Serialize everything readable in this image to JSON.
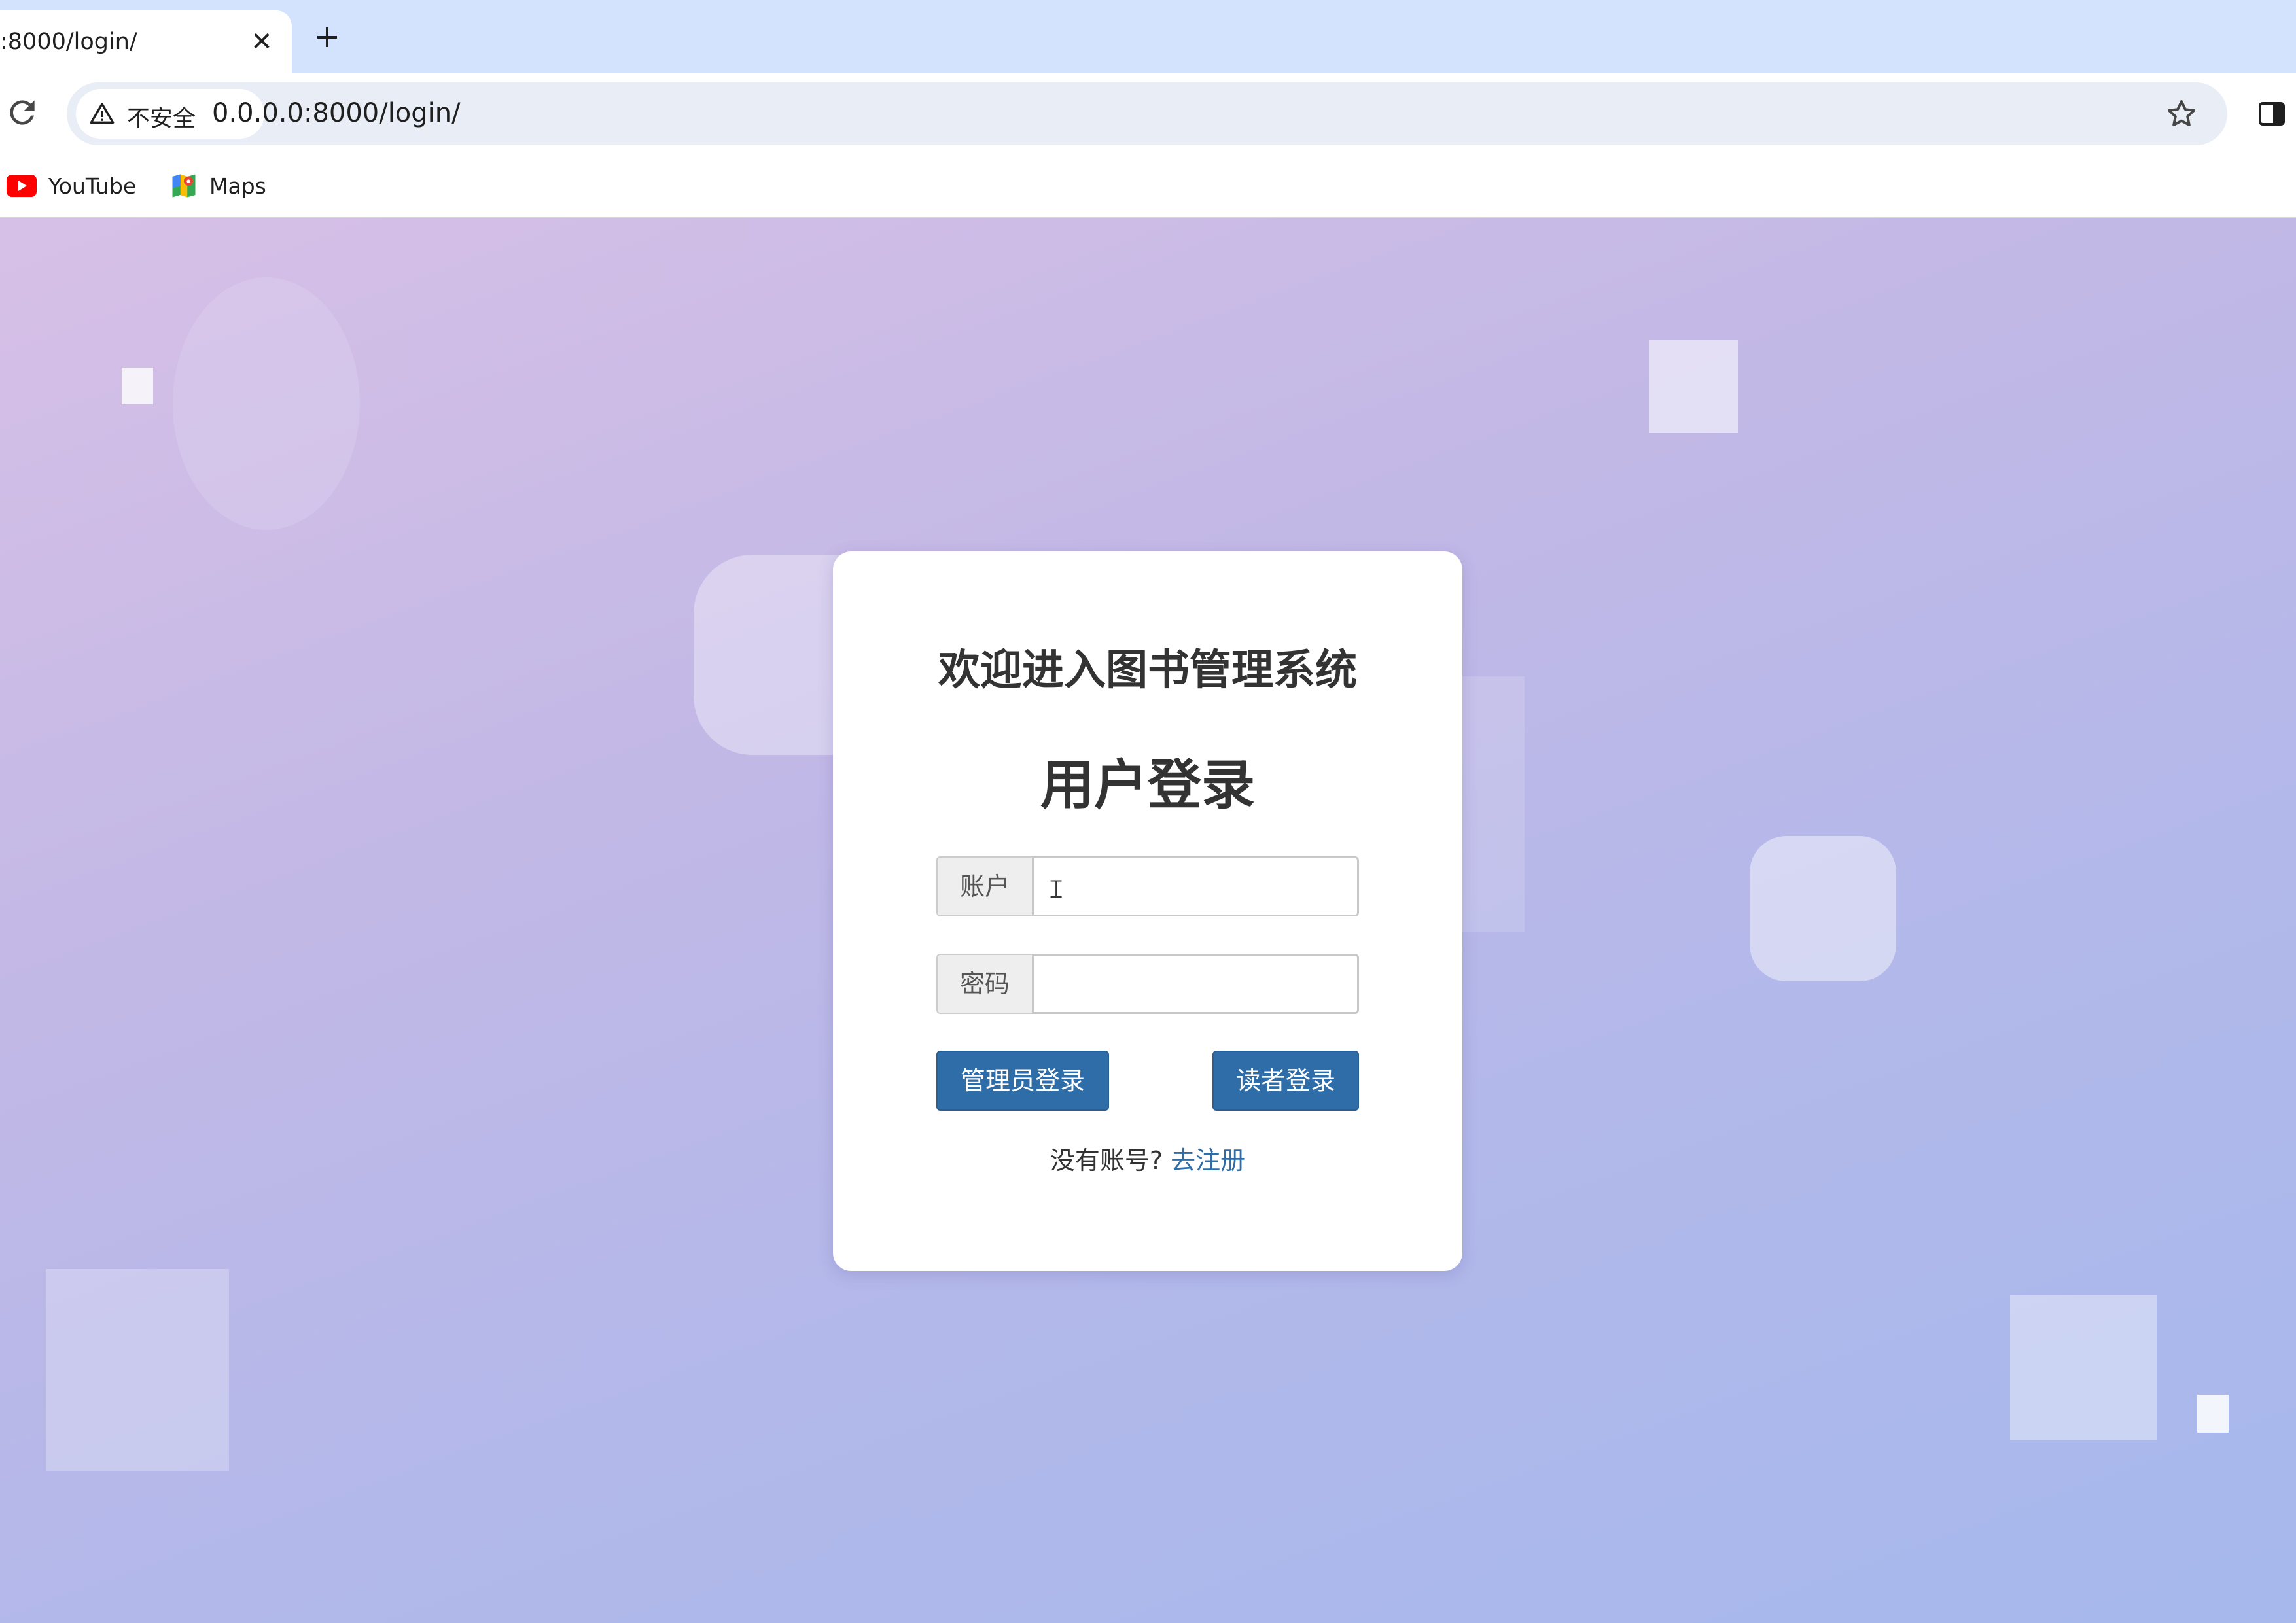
{
  "browser": {
    "tab_title": ":8000/login/",
    "tab_close": "✕",
    "new_tab": "+",
    "security_label": "不安全",
    "url": "0.0.0.0:8000/login/",
    "bookmarks": [
      {
        "label": "YouTube"
      },
      {
        "label": "Maps"
      }
    ]
  },
  "login": {
    "welcome": "欢迎进入图书管理系统",
    "title": "用户登录",
    "account_label": "账户",
    "account_value": "",
    "password_label": "密码",
    "password_value": "",
    "admin_button": "管理员登录",
    "reader_button": "读者登录",
    "no_account_text": "没有账号?",
    "register_link": "去注册"
  },
  "colors": {
    "primary_button": "#2f6da8",
    "link": "#2f6da8",
    "tab_strip": "#d3e3fd"
  }
}
